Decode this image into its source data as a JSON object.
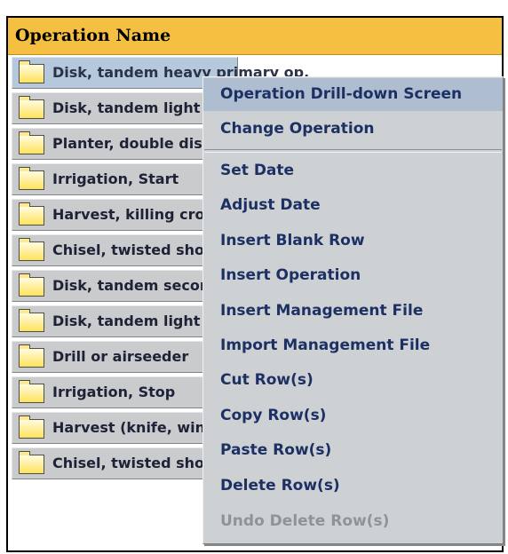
{
  "table": {
    "header": "Operation Name",
    "rows": [
      "Disk, tandem heavy primary op.",
      "Disk, tandem light finish",
      "Planter, double disk opnr",
      "Irrigation, Start",
      "Harvest, killing crop",
      "Chisel, twisted shovel",
      "Disk, tandem secondary op.",
      "Disk, tandem light finish",
      "Drill or airseeder",
      "Irrigation, Stop",
      "Harvest (knife, windrow)",
      "Chisel, twisted shovel"
    ]
  },
  "context_menu": {
    "items": [
      {
        "label": "Operation Drill-down Screen",
        "highlighted": true
      },
      {
        "label": "Change Operation"
      },
      {
        "label": "Set Date"
      },
      {
        "label": "Adjust Date"
      },
      {
        "label": "Insert Blank Row"
      },
      {
        "label": "Insert Operation"
      },
      {
        "label": "Insert Management File"
      },
      {
        "label": "Import Management File"
      },
      {
        "label": "Cut Row(s)"
      },
      {
        "label": "Copy Row(s)"
      },
      {
        "label": "Paste Row(s)"
      },
      {
        "label": "Delete Row(s)"
      },
      {
        "label": "Undo Delete Row(s)",
        "disabled": true
      }
    ]
  },
  "icons": {
    "row_icon": "folder-icon"
  },
  "colors": {
    "header_bg": "#f5c042",
    "selected_row": "#b5c8dc",
    "menu_bg": "#ced1d4",
    "menu_highlight": "#afbdd0"
  }
}
